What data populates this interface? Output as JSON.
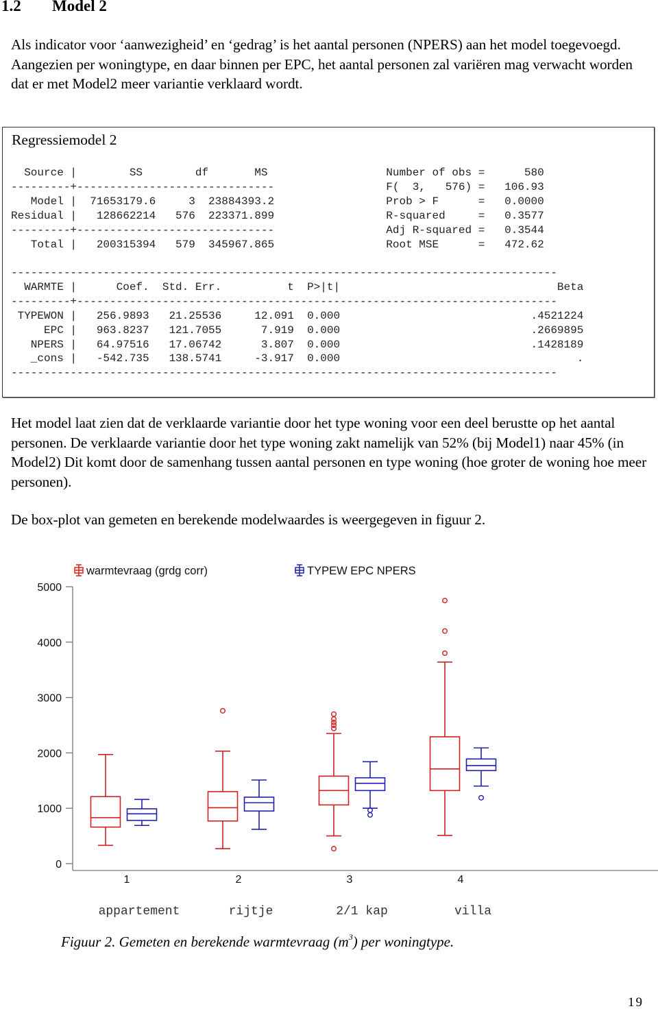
{
  "section": {
    "number": "1.2",
    "title": "Model 2"
  },
  "paragraphs": {
    "intro": "Als indicator voor ‘aanwezigheid’ en ‘gedrag’ is het aantal personen (NPERS) aan het model toegevoegd. Aangezien per woningtype, en daar binnen per EPC, het aantal personen zal variëren mag verwacht worden dat er met Model2 meer variantie verklaard wordt.",
    "discussion": "Het model laat zien dat de verklaarde variantie door het type woning voor een deel berustte op het aantal personen. De verklaarde variantie door het type woning zakt namelijk van 52% (bij Model1) naar 45% (in Model2) Dit komt door de samenhang tussen aantal personen en type woning (hoe groter de woning hoe meer personen).",
    "figure_ref": "De box-plot van gemeten en berekende modelwaardes is weergegeven in figuur 2."
  },
  "regression": {
    "title": "Regressiemodel 2",
    "anova_headers": [
      "Source",
      "SS",
      "df",
      "MS"
    ],
    "anova_rows": [
      {
        "source": "Model",
        "ss": "71653179.6",
        "df": "3",
        "ms": "23884393.2"
      },
      {
        "source": "Residual",
        "ss": "128662214",
        "df": "576",
        "ms": "223371.899"
      },
      {
        "source": "Total",
        "ss": "200315394",
        "df": "579",
        "ms": "345967.865"
      }
    ],
    "stats": [
      {
        "label": "Number of obs",
        "value": "580"
      },
      {
        "label": "F(  3,   576)",
        "value": "106.93"
      },
      {
        "label": "Prob > F",
        "value": "0.0000"
      },
      {
        "label": "R-squared",
        "value": "0.3577"
      },
      {
        "label": "Adj R-squared",
        "value": "0.3544"
      },
      {
        "label": "Root MSE",
        "value": "472.62"
      }
    ],
    "coef_headers": [
      "WARMTE",
      "Coef.",
      "Std. Err.",
      "t",
      "P>|t|",
      "Beta"
    ],
    "coef_rows": [
      {
        "var": "TYPEWON",
        "coef": "256.9893",
        "se": "21.25536",
        "t": "12.091",
        "p": "0.000",
        "beta": ".4521224"
      },
      {
        "var": "EPC",
        "coef": "963.8237",
        "se": "121.7055",
        "t": "7.919",
        "p": "0.000",
        "beta": ".2669895"
      },
      {
        "var": "NPERS",
        "coef": "64.97516",
        "se": "17.06742",
        "t": "3.807",
        "p": "0.000",
        "beta": ".1428189"
      },
      {
        "var": "_cons",
        "coef": "-542.735",
        "se": "138.5741",
        "t": "-3.917",
        "p": "0.000",
        "beta": "."
      }
    ]
  },
  "chart_data": {
    "type": "boxplot",
    "title": "",
    "xlabel": "",
    "ylabel": "",
    "ylim": [
      0,
      5000
    ],
    "yticks": [
      0,
      1000,
      2000,
      3000,
      4000,
      5000
    ],
    "grid": false,
    "legend_position": "top",
    "categories": [
      "1",
      "2",
      "3",
      "4"
    ],
    "category_names": [
      "appartement",
      "rijtje",
      "2/1 kap",
      "villa"
    ],
    "series": [
      {
        "name": "warmtevraag (grdg corr)",
        "color": "#d22020",
        "boxes": [
          {
            "whisker_low": 330,
            "q1": 660,
            "median": 830,
            "q3": 1210,
            "whisker_high": 1970,
            "outliers": []
          },
          {
            "whisker_low": 270,
            "q1": 770,
            "median": 1010,
            "q3": 1300,
            "whisker_high": 2030,
            "outliers": [
              2760
            ]
          },
          {
            "whisker_low": 500,
            "q1": 1060,
            "median": 1320,
            "q3": 1580,
            "whisker_high": 2350,
            "outliers": [
              270,
              2440,
              2500,
              2550,
              2610,
              2700
            ]
          },
          {
            "whisker_low": 510,
            "q1": 1320,
            "median": 1710,
            "q3": 2290,
            "whisker_high": 3640,
            "outliers": [
              3800,
              4200,
              4750
            ]
          }
        ]
      },
      {
        "name": "TYPEW EPC NPERS",
        "color": "#2020b0",
        "boxes": [
          {
            "whisker_low": 690,
            "q1": 780,
            "median": 900,
            "q3": 990,
            "whisker_high": 1160,
            "outliers": []
          },
          {
            "whisker_low": 620,
            "q1": 950,
            "median": 1100,
            "q3": 1200,
            "whisker_high": 1510,
            "outliers": []
          },
          {
            "whisker_low": 1000,
            "q1": 1320,
            "median": 1450,
            "q3": 1550,
            "whisker_high": 1840,
            "outliers": [
              880,
              965
            ]
          },
          {
            "whisker_low": 1400,
            "q1": 1680,
            "median": 1770,
            "q3": 1890,
            "whisker_high": 2090,
            "outliers": [
              1190
            ]
          }
        ]
      }
    ]
  },
  "figure": {
    "caption_prefix": "Figuur 2. Gemeten en berekende warmtevraag (m",
    "caption_sup": "3",
    "caption_suffix": ") per woningtype."
  },
  "page_number": "19"
}
